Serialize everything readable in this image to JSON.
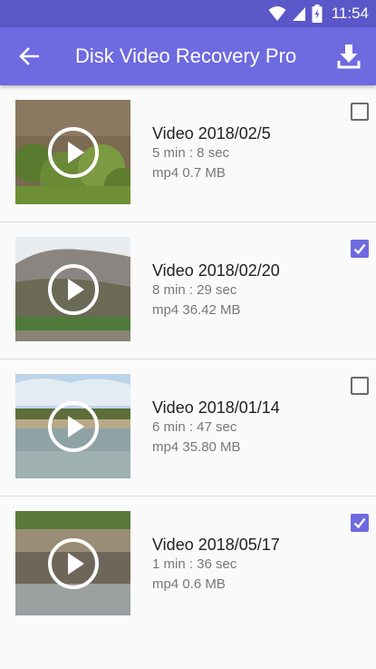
{
  "status_bar": {
    "time": "11:54",
    "icons": [
      "wifi-icon",
      "signal-icon",
      "battery-icon"
    ]
  },
  "app_bar": {
    "title": "Disk Video Recovery Pro",
    "back_icon": "arrow-left-icon",
    "download_icon": "download-icon"
  },
  "colors": {
    "status_bar": "#5a57c8",
    "app_bar": "#6e6ae0",
    "checkbox_checked": "#6e6ae0"
  },
  "videos": [
    {
      "title": "Video 2018/02/5",
      "duration": "5 min : 8 sec",
      "info": "mp4 0.7 MB",
      "checked": false
    },
    {
      "title": "Video 2018/02/20",
      "duration": "8 min : 29 sec",
      "info": "mp4 36.42 MB",
      "checked": true
    },
    {
      "title": "Video 2018/01/14",
      "duration": "6 min : 47 sec",
      "info": "mp4 35.80 MB",
      "checked": false
    },
    {
      "title": "Video 2018/05/17",
      "duration": "1 min : 36 sec",
      "info": "mp4 0.6 MB",
      "checked": true
    }
  ]
}
